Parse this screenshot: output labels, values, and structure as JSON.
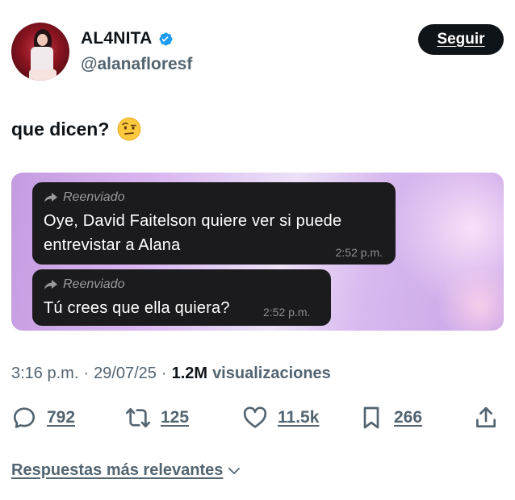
{
  "author": {
    "display_name": "AL4NITA",
    "handle": "@alanafloresf",
    "verified": true,
    "follow_label": "Seguir"
  },
  "tweet": {
    "text": "que dicen?",
    "emoji": "face-with-raised-eyebrow"
  },
  "media": {
    "messages": [
      {
        "forwarded_label": "Reenviado",
        "lines": [
          "Oye, David Faitelson quiere ver si puede",
          "entrevistar a Alana"
        ],
        "time": "2:52 p.m."
      },
      {
        "forwarded_label": "Reenviado",
        "lines": [
          "Tú crees que ella quiera?"
        ],
        "time": "2:52 p.m."
      }
    ]
  },
  "meta": {
    "time": "3:16 p.m.",
    "separator": "·",
    "date": "29/07/25",
    "views_count": "1.2M",
    "views_label": "visualizaciones"
  },
  "actions": {
    "replies": "792",
    "retweets": "125",
    "likes": "11.5k",
    "bookmarks": "266"
  },
  "sort": {
    "label": "Respuestas más relevantes"
  },
  "colors": {
    "verified_blue": "#1d9bf0",
    "text_primary": "#0f1419",
    "text_secondary": "#536471",
    "bubble_bg": "#1b1b1d"
  }
}
